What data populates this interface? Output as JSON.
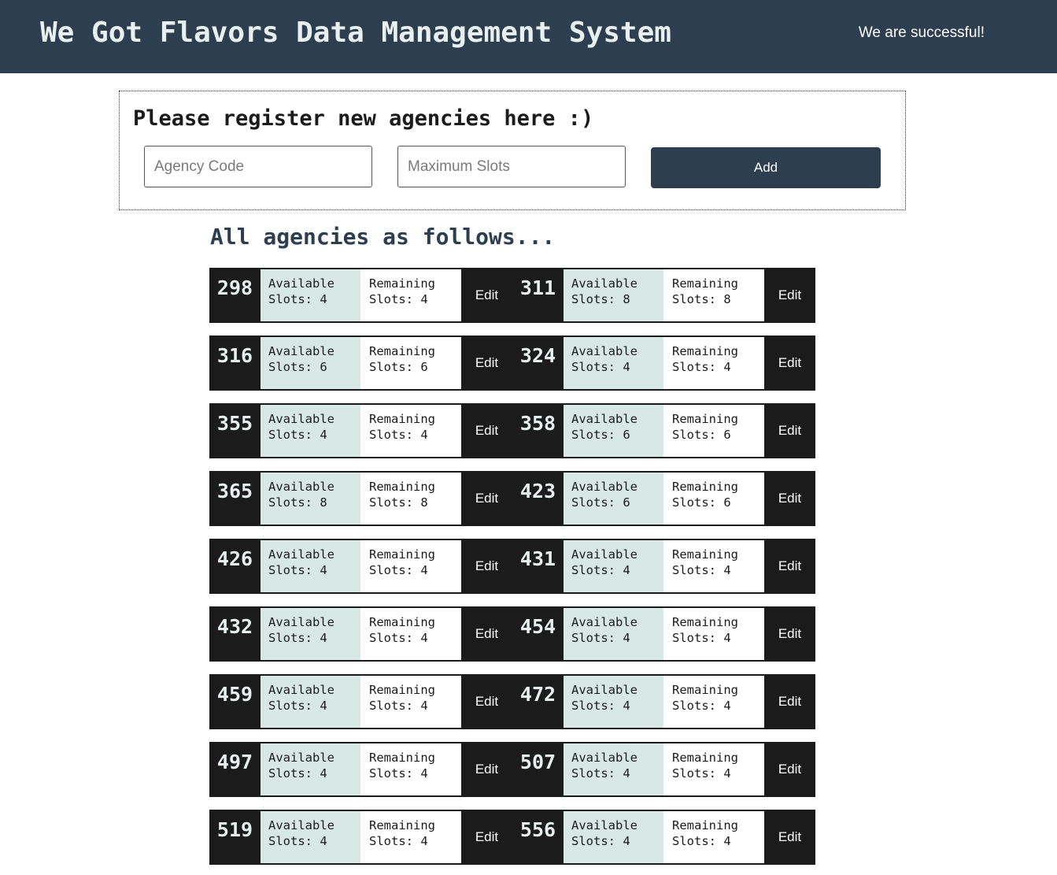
{
  "header": {
    "title": "We Got Flavors Data Management System",
    "status": "We are successful!"
  },
  "register": {
    "heading": "Please register new agencies here :)",
    "agency_code_placeholder": "Agency Code",
    "max_slots_placeholder": "Maximum Slots",
    "add_label": "Add"
  },
  "agencies": {
    "heading": "All agencies as follows...",
    "available_label": "Available",
    "remaining_label": "Remaining",
    "slots_prefix": "Slots:",
    "edit_label": "Edit",
    "items": [
      {
        "code": "298",
        "available": 4,
        "remaining": 4
      },
      {
        "code": "311",
        "available": 8,
        "remaining": 8
      },
      {
        "code": "316",
        "available": 6,
        "remaining": 6
      },
      {
        "code": "324",
        "available": 4,
        "remaining": 4
      },
      {
        "code": "355",
        "available": 4,
        "remaining": 4
      },
      {
        "code": "358",
        "available": 6,
        "remaining": 6
      },
      {
        "code": "365",
        "available": 8,
        "remaining": 8
      },
      {
        "code": "423",
        "available": 6,
        "remaining": 6
      },
      {
        "code": "426",
        "available": 4,
        "remaining": 4
      },
      {
        "code": "431",
        "available": 4,
        "remaining": 4
      },
      {
        "code": "432",
        "available": 4,
        "remaining": 4
      },
      {
        "code": "454",
        "available": 4,
        "remaining": 4
      },
      {
        "code": "459",
        "available": 4,
        "remaining": 4
      },
      {
        "code": "472",
        "available": 4,
        "remaining": 4
      },
      {
        "code": "497",
        "available": 4,
        "remaining": 4
      },
      {
        "code": "507",
        "available": 4,
        "remaining": 4
      },
      {
        "code": "519",
        "available": 4,
        "remaining": 4
      },
      {
        "code": "556",
        "available": 4,
        "remaining": 4
      }
    ]
  },
  "colors": {
    "header_bg": "#2d3e50",
    "card_dark": "#1b1b1b",
    "available_bg": "#d7e8e5",
    "remaining_bg": "#ffffff",
    "accent_button": "#2d3e50"
  }
}
